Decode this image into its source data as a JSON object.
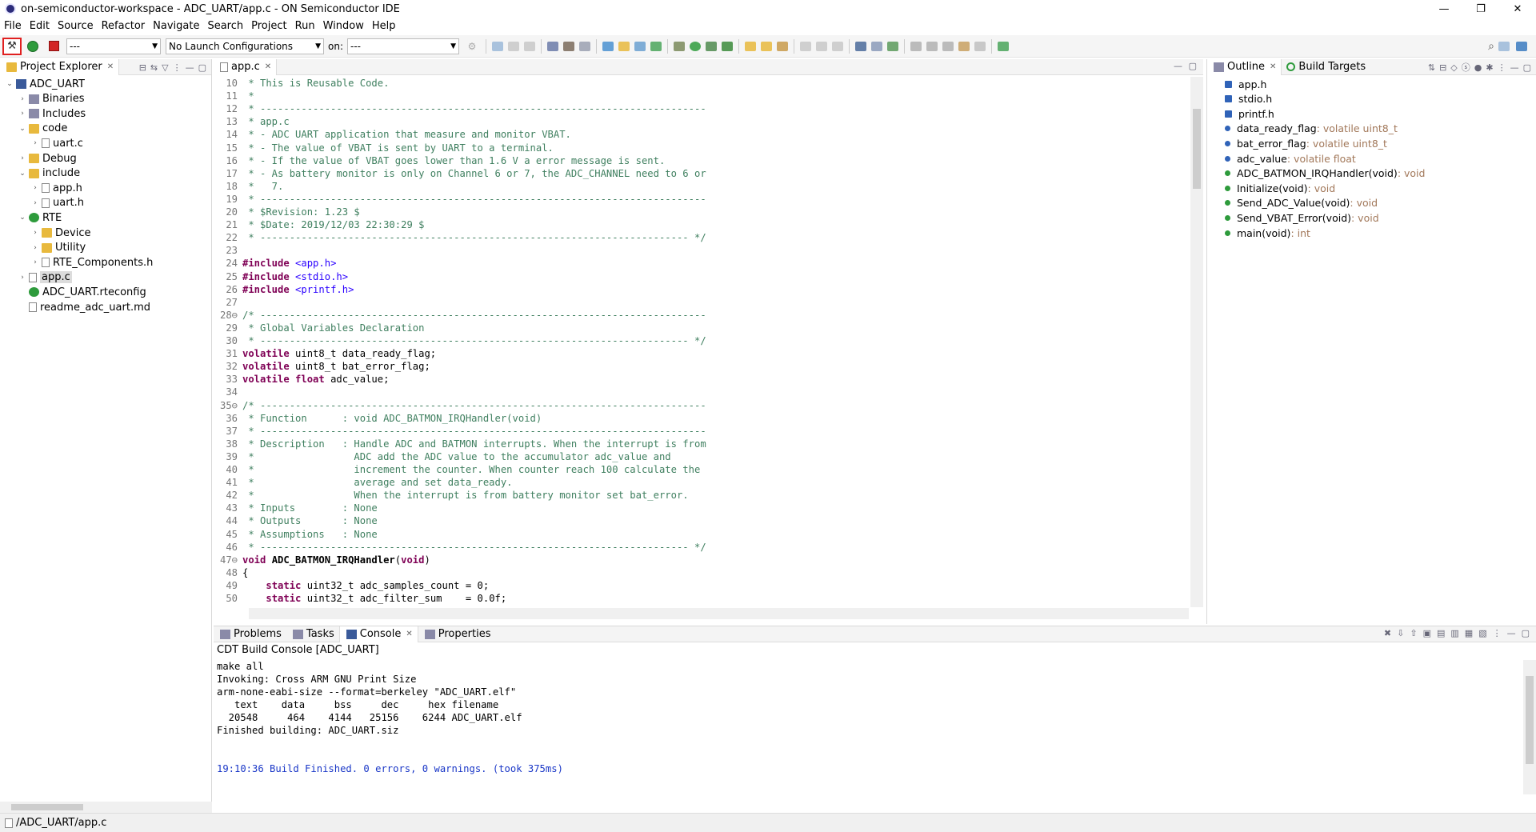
{
  "window": {
    "title": "on-semiconductor-workspace - ADC_UART/app.c - ON Semiconductor IDE",
    "controls": [
      "—",
      "❐",
      "✕"
    ]
  },
  "menu": [
    "File",
    "Edit",
    "Source",
    "Refactor",
    "Navigate",
    "Search",
    "Project",
    "Run",
    "Window",
    "Help"
  ],
  "toolbar": {
    "launch_mode": "---",
    "launch_config": "No Launch Configurations",
    "on_label": "on:",
    "target": "---"
  },
  "project_explorer": {
    "tab": "Project Explorer",
    "items": [
      {
        "label": "ADC_UART",
        "indent": 0,
        "arrow": "⌄",
        "icon": "proj"
      },
      {
        "label": "Binaries",
        "indent": 1,
        "arrow": "›",
        "icon": "lib"
      },
      {
        "label": "Includes",
        "indent": 1,
        "arrow": "›",
        "icon": "lib"
      },
      {
        "label": "code",
        "indent": 1,
        "arrow": "⌄",
        "icon": "folder"
      },
      {
        "label": "uart.c",
        "indent": 2,
        "arrow": "›",
        "icon": "file"
      },
      {
        "label": "Debug",
        "indent": 1,
        "arrow": "›",
        "icon": "folder"
      },
      {
        "label": "include",
        "indent": 1,
        "arrow": "⌄",
        "icon": "folder"
      },
      {
        "label": "app.h",
        "indent": 2,
        "arrow": "›",
        "icon": "file"
      },
      {
        "label": "uart.h",
        "indent": 2,
        "arrow": "›",
        "icon": "file"
      },
      {
        "label": "RTE",
        "indent": 1,
        "arrow": "⌄",
        "icon": "rte"
      },
      {
        "label": "Device",
        "indent": 2,
        "arrow": "›",
        "icon": "folder"
      },
      {
        "label": "Utility",
        "indent": 2,
        "arrow": "›",
        "icon": "folder"
      },
      {
        "label": "RTE_Components.h",
        "indent": 2,
        "arrow": "›",
        "icon": "file"
      },
      {
        "label": "app.c",
        "indent": 1,
        "arrow": "›",
        "icon": "file",
        "selected": true
      },
      {
        "label": "ADC_UART.rteconfig",
        "indent": 1,
        "arrow": "",
        "icon": "rte"
      },
      {
        "label": "readme_adc_uart.md",
        "indent": 1,
        "arrow": "",
        "icon": "file"
      }
    ]
  },
  "editor": {
    "tab": "app.c",
    "lines": [
      {
        "n": "10",
        "segs": [
          [
            "tx",
            " * This is Reusable Code."
          ]
        ]
      },
      {
        "n": "11",
        "segs": [
          [
            "tx",
            " *"
          ]
        ]
      },
      {
        "n": "12",
        "segs": [
          [
            "tx",
            " * ----------------------------------------------------------------------------"
          ]
        ]
      },
      {
        "n": "13",
        "segs": [
          [
            "tx",
            " * app.c"
          ]
        ]
      },
      {
        "n": "14",
        "segs": [
          [
            "tx",
            " * - ADC UART application that measure and monitor VBAT."
          ]
        ]
      },
      {
        "n": "15",
        "segs": [
          [
            "tx",
            " * - The value of VBAT is sent by UART to a terminal."
          ]
        ]
      },
      {
        "n": "16",
        "segs": [
          [
            "tx",
            " * - If the value of VBAT goes lower than 1.6 V a error message is sent."
          ]
        ]
      },
      {
        "n": "17",
        "segs": [
          [
            "tx",
            " * - As battery monitor is only on Channel 6 or 7, the ADC_CHANNEL need to 6 or"
          ]
        ]
      },
      {
        "n": "18",
        "segs": [
          [
            "tx",
            " *   7."
          ]
        ]
      },
      {
        "n": "19",
        "segs": [
          [
            "tx",
            " * ----------------------------------------------------------------------------"
          ]
        ]
      },
      {
        "n": "20",
        "segs": [
          [
            "tx",
            " * $Revision: 1.23 $"
          ]
        ]
      },
      {
        "n": "21",
        "segs": [
          [
            "tx",
            " * $Date: 2019/12/03 22:30:29 $"
          ]
        ]
      },
      {
        "n": "22",
        "segs": [
          [
            "tx",
            " * ------------------------------------------------------------------------- */"
          ]
        ]
      },
      {
        "n": "23",
        "segs": [
          [
            "pl",
            ""
          ]
        ]
      },
      {
        "n": "24",
        "segs": [
          [
            "pp",
            "#include "
          ],
          [
            "inc",
            "<app.h>"
          ]
        ]
      },
      {
        "n": "25",
        "segs": [
          [
            "pp",
            "#include "
          ],
          [
            "inc",
            "<stdio.h>"
          ]
        ]
      },
      {
        "n": "26",
        "segs": [
          [
            "pp",
            "#include "
          ],
          [
            "inc",
            "<printf.h>"
          ]
        ]
      },
      {
        "n": "27",
        "segs": [
          [
            "pl",
            ""
          ]
        ]
      },
      {
        "n": "28⊖",
        "segs": [
          [
            "tx",
            "/* ----------------------------------------------------------------------------"
          ]
        ]
      },
      {
        "n": "29",
        "segs": [
          [
            "tx",
            " * Global Variables Declaration"
          ]
        ]
      },
      {
        "n": "30",
        "segs": [
          [
            "tx",
            " * ------------------------------------------------------------------------- */"
          ]
        ]
      },
      {
        "n": "31",
        "segs": [
          [
            "kw",
            "volatile "
          ],
          [
            "pl",
            "uint8_t data_ready_flag;"
          ]
        ]
      },
      {
        "n": "32",
        "segs": [
          [
            "kw",
            "volatile "
          ],
          [
            "pl",
            "uint8_t bat_error_flag;"
          ]
        ]
      },
      {
        "n": "33",
        "segs": [
          [
            "kw",
            "volatile float "
          ],
          [
            "pl",
            "adc_value;"
          ]
        ]
      },
      {
        "n": "34",
        "segs": [
          [
            "pl",
            ""
          ]
        ]
      },
      {
        "n": "35⊖",
        "segs": [
          [
            "tx",
            "/* ----------------------------------------------------------------------------"
          ]
        ]
      },
      {
        "n": "36",
        "segs": [
          [
            "tx",
            " * Function      : void ADC_BATMON_IRQHandler(void)"
          ]
        ]
      },
      {
        "n": "37",
        "segs": [
          [
            "tx",
            " * ----------------------------------------------------------------------------"
          ]
        ]
      },
      {
        "n": "38",
        "segs": [
          [
            "tx",
            " * Description   : Handle ADC and BATMON interrupts. When the interrupt is from"
          ]
        ]
      },
      {
        "n": "39",
        "segs": [
          [
            "tx",
            " *                 ADC add the ADC value to the accumulator adc_value and"
          ]
        ]
      },
      {
        "n": "40",
        "segs": [
          [
            "tx",
            " *                 increment the counter. When counter reach 100 calculate the"
          ]
        ]
      },
      {
        "n": "41",
        "segs": [
          [
            "tx",
            " *                 average and set data_ready."
          ]
        ]
      },
      {
        "n": "42",
        "segs": [
          [
            "tx",
            " *                 When the interrupt is from battery monitor set bat_error."
          ]
        ]
      },
      {
        "n": "43",
        "segs": [
          [
            "tx",
            " * Inputs        : None"
          ]
        ]
      },
      {
        "n": "44",
        "segs": [
          [
            "tx",
            " * Outputs       : None"
          ]
        ]
      },
      {
        "n": "45",
        "segs": [
          [
            "tx",
            " * Assumptions   : None"
          ]
        ]
      },
      {
        "n": "46",
        "segs": [
          [
            "tx",
            " * ------------------------------------------------------------------------- */"
          ]
        ]
      },
      {
        "n": "47⊖",
        "segs": [
          [
            "kw",
            "void "
          ],
          [
            "fn",
            "ADC_BATMON_IRQHandler"
          ],
          [
            "pl",
            "("
          ],
          [
            "kw",
            "void"
          ],
          [
            "pl",
            ")"
          ]
        ]
      },
      {
        "n": "48",
        "segs": [
          [
            "pl",
            "{"
          ]
        ]
      },
      {
        "n": "49",
        "segs": [
          [
            "pl",
            "    "
          ],
          [
            "kw",
            "static "
          ],
          [
            "pl",
            "uint32_t adc_samples_count = 0;"
          ]
        ]
      },
      {
        "n": "50",
        "segs": [
          [
            "pl",
            "    "
          ],
          [
            "kw",
            "static "
          ],
          [
            "pl",
            "uint32_t adc_filter_sum    = 0.0f;"
          ]
        ]
      },
      {
        "n": "51",
        "segs": [
          [
            "pl",
            ""
          ]
        ]
      }
    ]
  },
  "outline": {
    "tabs": [
      "Outline",
      "Build Targets"
    ],
    "items": [
      {
        "kind": "hd",
        "name": "app.h",
        "type": ""
      },
      {
        "kind": "hd",
        "name": "stdio.h",
        "type": ""
      },
      {
        "kind": "hd",
        "name": "printf.h",
        "type": ""
      },
      {
        "kind": "var",
        "name": "data_ready_flag",
        "type": " : volatile uint8_t"
      },
      {
        "kind": "var",
        "name": "bat_error_flag",
        "type": " : volatile uint8_t"
      },
      {
        "kind": "var",
        "name": "adc_value",
        "type": " : volatile float"
      },
      {
        "kind": "fn",
        "name": "ADC_BATMON_IRQHandler(void)",
        "type": " : void"
      },
      {
        "kind": "fn",
        "name": "Initialize(void)",
        "type": " : void"
      },
      {
        "kind": "fn",
        "name": "Send_ADC_Value(void)",
        "type": " : void"
      },
      {
        "kind": "fn",
        "name": "Send_VBAT_Error(void)",
        "type": " : void"
      },
      {
        "kind": "fn",
        "name": "main(void)",
        "type": " : int"
      }
    ]
  },
  "bottom": {
    "tabs": [
      "Problems",
      "Tasks",
      "Console",
      "Properties"
    ],
    "console_title": "CDT Build Console [ADC_UART]",
    "lines": [
      "make all",
      "Invoking: Cross ARM GNU Print Size",
      "arm-none-eabi-size --format=berkeley \"ADC_UART.elf\"",
      "   text    data     bss     dec     hex filename",
      "  20548     464    4144   25156    6244 ADC_UART.elf",
      "Finished building: ADC_UART.siz",
      "",
      "",
      "19:10:36 Build Finished. 0 errors, 0 warnings. (took 375ms)"
    ]
  },
  "status": {
    "path": "/ADC_UART/app.c"
  }
}
